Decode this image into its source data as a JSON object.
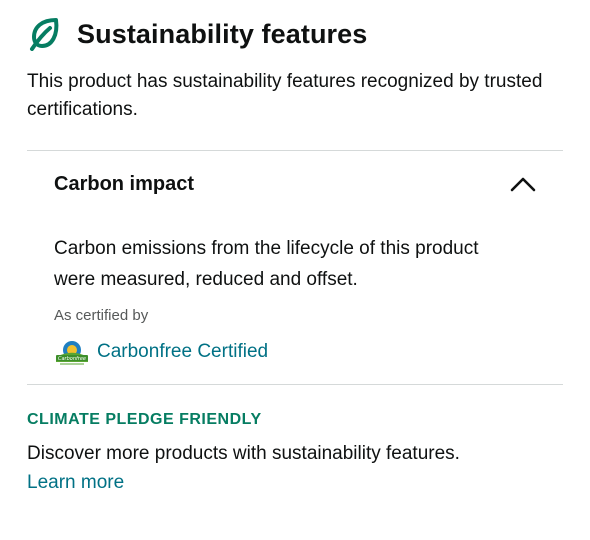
{
  "header": {
    "icon": "leaf-icon",
    "title": "Sustainability features"
  },
  "intro": "This product has sustainability features recognized by trusted certifications.",
  "accordion": {
    "title": "Carbon impact",
    "expanded": true,
    "toggle_icon": "chevron-up-icon",
    "body_text": "Carbon emissions from the lifecycle of this product were measured, reduced and offset.",
    "certified_by": "As certified by",
    "certification": {
      "logo_icon": "carbonfree-logo-icon",
      "logo_text": "Carbonfree",
      "link_label": "Carbonfree Certified"
    }
  },
  "pledge": {
    "badge_text": "CLIMATE PLEDGE FRIENDLY",
    "description": "Discover more products with sustainability features.",
    "learn_more_label": "Learn more"
  },
  "colors": {
    "text": "#0f1111",
    "link": "#007185",
    "pledge_green": "#067d62",
    "divider": "#d5d9d9",
    "muted": "#565959"
  }
}
